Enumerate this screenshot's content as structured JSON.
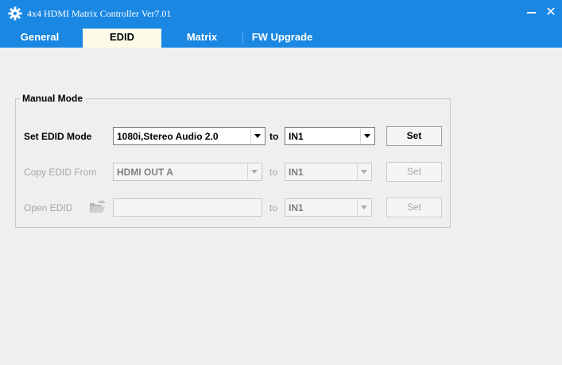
{
  "window": {
    "title": "4x4 HDMI Matrix Controller Ver7.01",
    "icons": {
      "app": "gear-icon",
      "minimize": "minimize-icon",
      "close": "close-icon"
    },
    "colors": {
      "titlebar": "#1a87e3",
      "active_tab": "#fbfbe8",
      "background": "#efefef"
    }
  },
  "tabs": [
    {
      "label": "General"
    },
    {
      "label": "EDID"
    },
    {
      "label": "Matrix"
    },
    {
      "label": "FW Upgrade"
    }
  ],
  "active_tab": "EDID",
  "manual_mode": {
    "title": "Manual Mode",
    "set_edid": {
      "label": "Set EDID Mode",
      "mode_value": "1080i,Stereo Audio 2.0",
      "to_label": "to",
      "target_value": "IN1",
      "button": "Set"
    },
    "copy_edid": {
      "label": "Copy EDID From",
      "source_value": "HDMI OUT A",
      "to_label": "to",
      "target_value": "IN1",
      "button": "Set"
    },
    "open_edid": {
      "label": "Open EDID",
      "icon": "open-folder-icon",
      "file_value": "",
      "to_label": "to",
      "target_value": "IN1",
      "button": "Set"
    }
  }
}
